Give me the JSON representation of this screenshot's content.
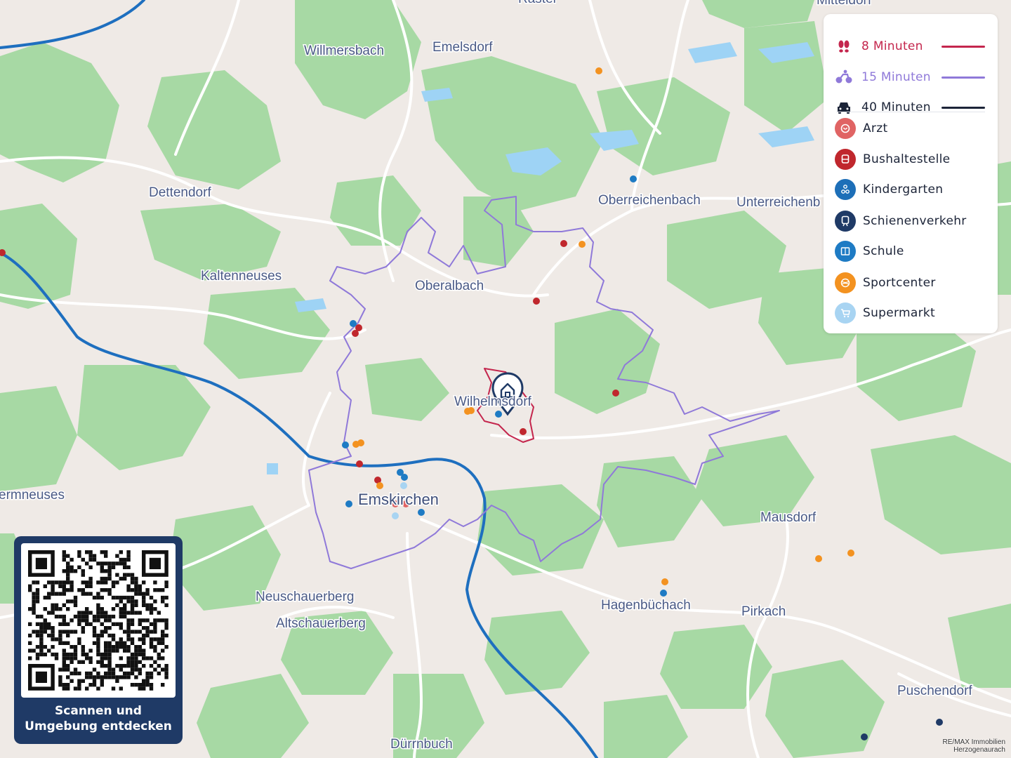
{
  "towns": [
    {
      "name": "Willmersbach"
    },
    {
      "name": "Emelsdorf"
    },
    {
      "name": "Dettendorf"
    },
    {
      "name": "Oberreichenbach"
    },
    {
      "name": "Unterreichenb"
    },
    {
      "name": "Kaltenneuses"
    },
    {
      "name": "Oberalbach"
    },
    {
      "name": "Wilhelmsdorf"
    },
    {
      "name": "Emskirchen"
    },
    {
      "name": "ermneuses"
    },
    {
      "name": "Mausdorf"
    },
    {
      "name": "Neuschauerberg"
    },
    {
      "name": "Altschauerberg"
    },
    {
      "name": "Hagenbüchach"
    },
    {
      "name": "Pirkach"
    },
    {
      "name": "Puschendorf"
    },
    {
      "name": "Dürrnbuch"
    },
    {
      "name": "Raster"
    },
    {
      "name": "Mitteldorf"
    }
  ],
  "legend": {
    "travel": [
      {
        "icon": "walking-icon",
        "label": "8 Minuten",
        "color": "#c4264d"
      },
      {
        "icon": "bicycle-icon",
        "label": "15 Minuten",
        "color": "#8f79d9"
      },
      {
        "icon": "car-icon",
        "label": "40 Minuten",
        "color": "#1c2438"
      }
    ],
    "poi": [
      {
        "icon": "doctor-icon",
        "label": "Arzt",
        "color": "#e06464"
      },
      {
        "icon": "bus-icon",
        "label": "Bushaltestelle",
        "color": "#c0272d"
      },
      {
        "icon": "kindergarten-icon",
        "label": "Kindergarten",
        "color": "#1d6fb8"
      },
      {
        "icon": "train-icon",
        "label": "Schienenverkehr",
        "color": "#1f3a66"
      },
      {
        "icon": "school-icon",
        "label": "Schule",
        "color": "#1e7bc4"
      },
      {
        "icon": "sport-icon",
        "label": "Sportcenter",
        "color": "#f39220"
      },
      {
        "icon": "supermarket-icon",
        "label": "Supermarkt",
        "color": "#a8d4f2"
      }
    ]
  },
  "qr": {
    "caption_line1": "Scannen und",
    "caption_line2": "Umgebung entdecken"
  },
  "credit": {
    "line1": "RE/MAX Immobilien",
    "line2": "Herzogenaurach"
  },
  "colors": {
    "map_base": "#efeae6",
    "forest": "#a7d9a4",
    "water": "#9ed3f5",
    "rail": "#1e6fbf",
    "road": "#ffffff"
  }
}
